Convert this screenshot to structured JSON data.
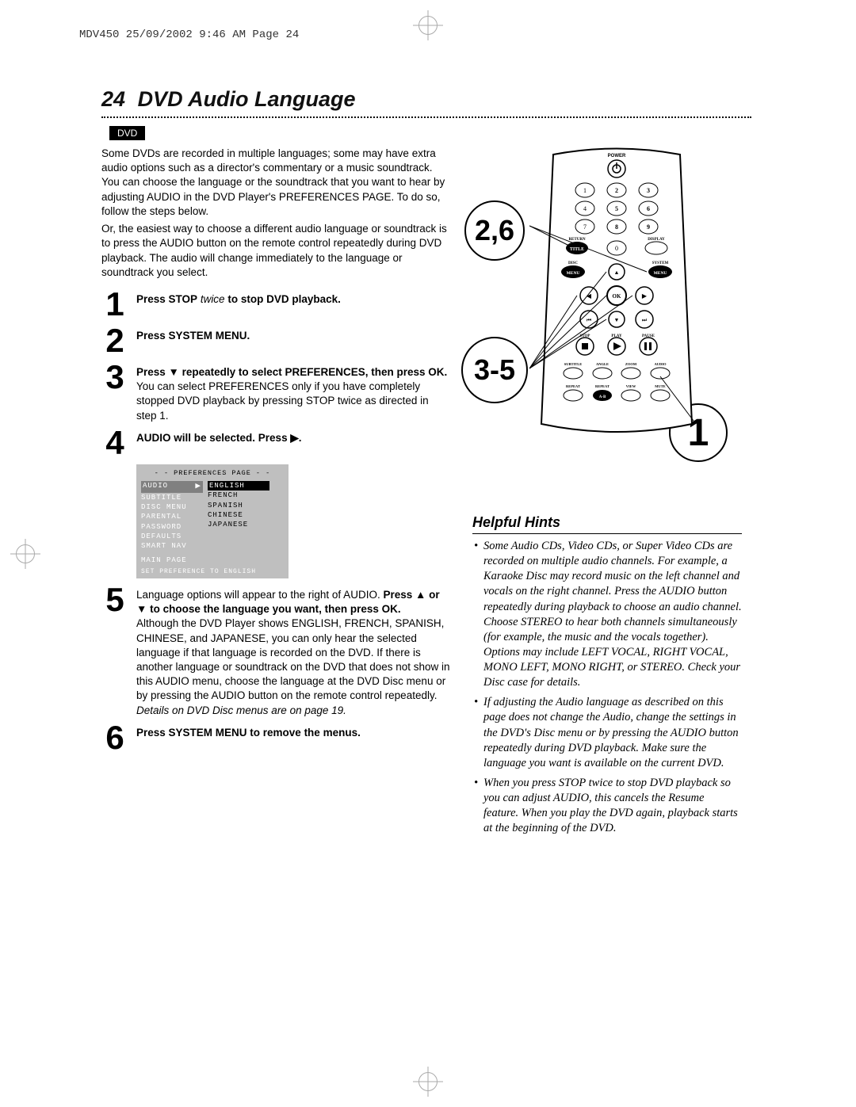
{
  "header": "MDV450  25/09/2002  9:46 AM  Page 24",
  "pageNumber": "24",
  "title": "DVD Audio Language",
  "tag": "DVD",
  "intro1": "Some DVDs are recorded in multiple languages; some may have extra audio options such as a director's commentary or a music soundtrack. You can choose the language or the soundtrack that you want to hear by adjusting AUDIO in the DVD Player's PREFERENCES PAGE. To do so, follow the steps below.",
  "intro2": "Or, the easiest way to choose a different audio language or soundtrack is to press the AUDIO button on the remote control repeatedly during DVD playback. The audio will change immediately to the language or soundtrack you select.",
  "steps": {
    "s1": {
      "bold": "Press STOP",
      "italic": "twice",
      "rest": " to stop DVD playback."
    },
    "s2": {
      "bold": "Press SYSTEM MENU."
    },
    "s3": {
      "bold": "Press ▼ repeatedly to select PREFERENCES, then press OK.",
      "rest": " You can select PREFERENCES only if you have completely stopped DVD playback by pressing STOP twice as directed in step 1."
    },
    "s4": {
      "bold": "AUDIO will be selected. Press ▶."
    },
    "s5": {
      "pre": "Language options will appear to the right of AUDIO. ",
      "bold": "Press ▲ or ▼ to choose the language you want, then press OK.",
      "rest": "Although the DVD Player shows ENGLISH, FRENCH, SPANISH, CHINESE, and JAPANESE, you can only hear the selected language if that language is recorded on the DVD. If there is another language or soundtrack on the DVD that does not show in this AUDIO menu, choose the language at the DVD Disc menu or by pressing the AUDIO button on the remote control repeatedly. ",
      "italic": "Details on DVD Disc menus are on page 19."
    },
    "s6": {
      "bold": "Press SYSTEM MENU to remove the menus."
    }
  },
  "osd": {
    "title": "- -  PREFERENCES PAGE  - -",
    "left": [
      "AUDIO",
      "SUBTITLE",
      "DISC MENU",
      "PARENTAL",
      "PASSWORD",
      "DEFAULTS",
      "SMART NAV"
    ],
    "right": [
      "ENGLISH",
      "FRENCH",
      "SPANISH",
      "CHINESE",
      "JAPANESE"
    ],
    "main": "MAIN PAGE",
    "footer": "SET PREFERENCE TO ENGLISH"
  },
  "callouts": {
    "c26": "2,6",
    "c35": "3-5",
    "c1": "1"
  },
  "remoteLabels": {
    "power": "POWER",
    "return": "RETURN",
    "title": "TITLE",
    "display": "DISPLAY",
    "disc": "DISC",
    "system": "SYSTEM",
    "menu1": "MENU",
    "menu2": "MENU",
    "ok": "OK",
    "stop": "STOP",
    "play": "PLAY",
    "pause": "PAUSE",
    "subtitle": "SUBTITLE",
    "angle": "ANGLE",
    "zoom": "ZOOM",
    "audio": "AUDIO",
    "repeat": "REPEAT",
    "repeat2": "REPEAT",
    "view": "VIEW",
    "mute": "MUTE",
    "ab": "A-B"
  },
  "hintsTitle": "Helpful Hints",
  "hints": [
    "Some Audio CDs, Video CDs, or Super Video CDs are recorded on multiple audio channels. For example, a Karaoke Disc may record music on the left channel and vocals on the right channel. Press the AUDIO button repeatedly during playback to choose an audio channel. Choose STEREO to hear both channels simultaneously (for example, the music and the vocals together). Options may include LEFT VOCAL, RIGHT VOCAL, MONO LEFT, MONO RIGHT, or STEREO. Check your Disc case for details.",
    "If adjusting the Audio language as described on this page does not change the Audio, change the settings in the DVD's Disc menu or by pressing the AUDIO button repeatedly during DVD playback. Make sure the language you want is available on the current DVD.",
    "When you press STOP twice to stop DVD playback so you can adjust AUDIO, this cancels the Resume feature. When you play the DVD again, playback starts at the beginning of the DVD."
  ]
}
